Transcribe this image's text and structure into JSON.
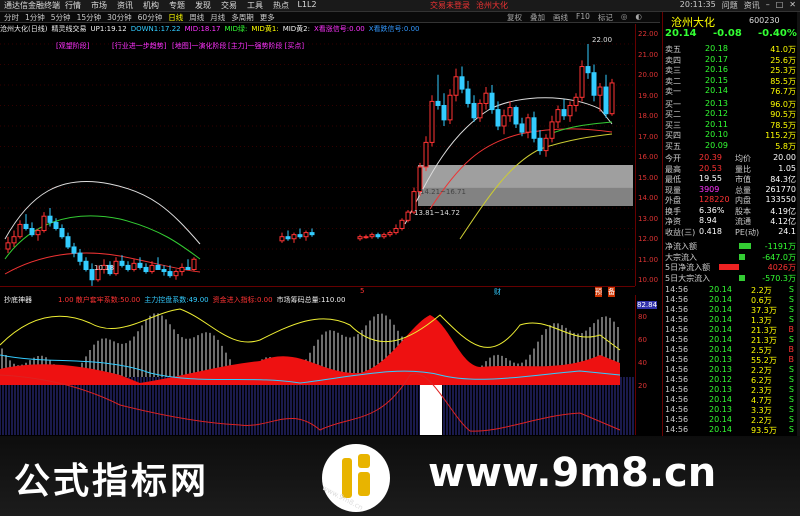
{
  "titlebar": {
    "app": "通达信金融终端",
    "menus": [
      "行情",
      "市场",
      "资讯",
      "机构",
      "专题",
      "发现",
      "交易",
      "工具",
      "热点",
      "L1L2"
    ],
    "center_trade": "交易未登录",
    "center_stock": "沧州大化",
    "right_time": "20:11:35",
    "right_icons": [
      "问题",
      "资讯"
    ]
  },
  "toolbar": {
    "items": [
      "分时",
      "1分钟",
      "5分钟",
      "15分钟",
      "30分钟",
      "60分钟",
      "日线",
      "周线",
      "月线",
      "多周期",
      "更多"
    ],
    "active": "日线",
    "right_icons": [
      "复权",
      "叠加",
      "画线",
      "F10",
      "标记",
      "◎",
      "◐"
    ]
  },
  "infobar": {
    "stock": "沧州大化(日线)",
    "indicator": "精灵线交易",
    "up1_label": "UP1:",
    "up1": "19.12",
    "down1_label": "DOWN1:",
    "down1": "17.22",
    "mid_label": "MID:",
    "mid": "18.17",
    "mid_green": "MID绿:",
    "mid_yellow": "MID黄1:",
    "mid_yellow2": "MID黄2:",
    "buy_signal": "X看涨信号:",
    "buy_val": "0.00",
    "sell_signal": "X看跌信号:",
    "sell_val": "0.00"
  },
  "signals": {
    "s1": "[观望阶段]",
    "s2": "[行业进一步趋势]",
    "s3": "[地图]一演化阶段",
    "s4": "[主力]一强势阶段 [买点]"
  },
  "mainchart": {
    "price_high": "22.00",
    "price_low": "10.18",
    "range1": "14.21~16.71",
    "range2": "13.81~14.72",
    "axis": [
      "22.00",
      "21.00",
      "20.00",
      "19.00",
      "18.00",
      "17.00",
      "16.00",
      "15.00",
      "14.00",
      "13.00",
      "12.00",
      "11.00",
      "10.00"
    ]
  },
  "xbar": {
    "labels": [
      "5",
      "财",
      "预",
      "备"
    ]
  },
  "indicator": {
    "name": "抄底神器",
    "a_label": "1.00 散户套牢系数:",
    "a_val": "50.00",
    "b_label": "主力控盘系数:",
    "b_val": "49.00",
    "c_label": "资金进入指标:",
    "c_val": "0.00",
    "d_label": "市场筹码总量:",
    "d_val": "110.00",
    "axis": [
      "82.84",
      "80",
      "60",
      "40",
      "20"
    ]
  },
  "panel": {
    "name": "沧州大化",
    "code": "600230",
    "price": "20.14",
    "change": "-0.08",
    "pct": "-0.40%",
    "asks": [
      {
        "label": "卖五",
        "price": "20.18",
        "vol": "41.0万"
      },
      {
        "label": "卖四",
        "price": "20.17",
        "vol": "25.6万"
      },
      {
        "label": "卖三",
        "price": "20.16",
        "vol": "25.3万"
      },
      {
        "label": "卖二",
        "price": "20.15",
        "vol": "85.5万"
      },
      {
        "label": "卖一",
        "price": "20.14",
        "vol": "76.7万"
      }
    ],
    "bids": [
      {
        "label": "买一",
        "price": "20.13",
        "vol": "96.0万"
      },
      {
        "label": "买二",
        "price": "20.12",
        "vol": "90.5万"
      },
      {
        "label": "买三",
        "price": "20.11",
        "vol": "78.5万"
      },
      {
        "label": "买四",
        "price": "20.10",
        "vol": "115.2万"
      },
      {
        "label": "买五",
        "price": "20.09",
        "vol": "5.8万"
      }
    ],
    "stats": [
      {
        "l1": "今开",
        "v1": "20.39",
        "l2": "均价",
        "v2": "20.00"
      },
      {
        "l1": "最高",
        "v1": "20.53",
        "l2": "量比",
        "v2": "1.05"
      },
      {
        "l1": "最低",
        "v1": "19.55",
        "l2": "市值",
        "v2": "84.3亿"
      },
      {
        "l1": "现量",
        "v1": "3909",
        "l2": "总量",
        "v2": "261770"
      },
      {
        "l1": "外盘",
        "v1": "128220",
        "l2": "内盘",
        "v2": "133550"
      },
      {
        "l1": "换手",
        "v1": "6.36%",
        "l2": "股本",
        "v2": "4.19亿"
      },
      {
        "l1": "净资",
        "v1": "8.94",
        "l2": "流通",
        "v2": "4.12亿"
      },
      {
        "l1": "收益(三)",
        "v1": "0.418",
        "l2": "PE(动)",
        "v2": "24.1"
      }
    ],
    "flows": [
      {
        "label": "净流入额",
        "val": "-1191万"
      },
      {
        "label": "大宗流入",
        "val": "-647.0万"
      },
      {
        "label": "5日净流入额",
        "val": "4026万"
      },
      {
        "label": "5日大宗流入",
        "val": "-570.3万"
      }
    ],
    "ticks": [
      {
        "t": "14:56",
        "p": "20.14",
        "v": "2.2万",
        "f": "S"
      },
      {
        "t": "14:56",
        "p": "20.14",
        "v": "0.6万",
        "f": "S"
      },
      {
        "t": "14:56",
        "p": "20.14",
        "v": "37.3万",
        "f": "S"
      },
      {
        "t": "14:56",
        "p": "20.14",
        "v": "1.3万",
        "f": "S"
      },
      {
        "t": "14:56",
        "p": "20.14",
        "v": "21.3万",
        "f": "B"
      },
      {
        "t": "14:56",
        "p": "20.14",
        "v": "21.3万",
        "f": "S"
      },
      {
        "t": "14:56",
        "p": "20.14",
        "v": "2.5万",
        "f": "B"
      },
      {
        "t": "14:56",
        "p": "20.13",
        "v": "55.2万",
        "f": "B"
      },
      {
        "t": "14:56",
        "p": "20.13",
        "v": "2.2万",
        "f": "S"
      },
      {
        "t": "14:56",
        "p": "20.12",
        "v": "6.2万",
        "f": "S"
      },
      {
        "t": "14:56",
        "p": "20.13",
        "v": "2.3万",
        "f": "S"
      },
      {
        "t": "14:56",
        "p": "20.14",
        "v": "4.7万",
        "f": "S"
      },
      {
        "t": "14:56",
        "p": "20.13",
        "v": "3.3万",
        "f": "S"
      },
      {
        "t": "14:56",
        "p": "20.14",
        "v": "2.2万",
        "f": "S"
      },
      {
        "t": "14:56",
        "p": "20.14",
        "v": "93.5万",
        "f": "S"
      }
    ]
  },
  "watermark": {
    "left": "公式指标网",
    "right": "www.9m8.cn",
    "logo_url": "www.9m8.cn"
  }
}
